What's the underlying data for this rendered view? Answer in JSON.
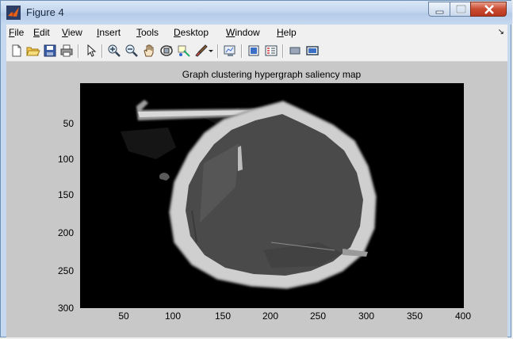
{
  "window": {
    "title": "Figure 4",
    "accent": "#c3d6ef"
  },
  "menu": [
    {
      "label": "File",
      "key": "F",
      "rest": "ile"
    },
    {
      "label": "Edit",
      "key": "E",
      "rest": "dit"
    },
    {
      "label": "View",
      "key": "V",
      "rest": "iew"
    },
    {
      "label": "Insert",
      "key": "I",
      "rest": "nsert"
    },
    {
      "label": "Tools",
      "key": "T",
      "rest": "ools"
    },
    {
      "label": "Desktop",
      "key": "D",
      "rest": "esktop"
    },
    {
      "label": "Window",
      "key": "W",
      "rest": "indow"
    },
    {
      "label": "Help",
      "key": "H",
      "rest": "elp"
    }
  ],
  "toolbar": {
    "icons": [
      "new-figure-icon",
      "open-file-icon",
      "save-icon",
      "print-icon",
      "pointer-icon",
      "zoom-in-icon",
      "zoom-out-icon",
      "pan-icon",
      "rotate-3d-icon",
      "data-cursor-icon",
      "brush-icon",
      "dropdown-arrow-icon",
      "link-plot-icon",
      "colorbar-icon",
      "legend-icon",
      "hide-plot-tools-icon",
      "show-plot-tools-icon"
    ]
  },
  "figure": {
    "title": "Graph clustering hypergraph saliency map",
    "yticks": [
      "50",
      "100",
      "150",
      "200",
      "250",
      "300"
    ],
    "xticks": [
      "50",
      "100",
      "150",
      "200",
      "250",
      "300",
      "350",
      "400"
    ]
  }
}
